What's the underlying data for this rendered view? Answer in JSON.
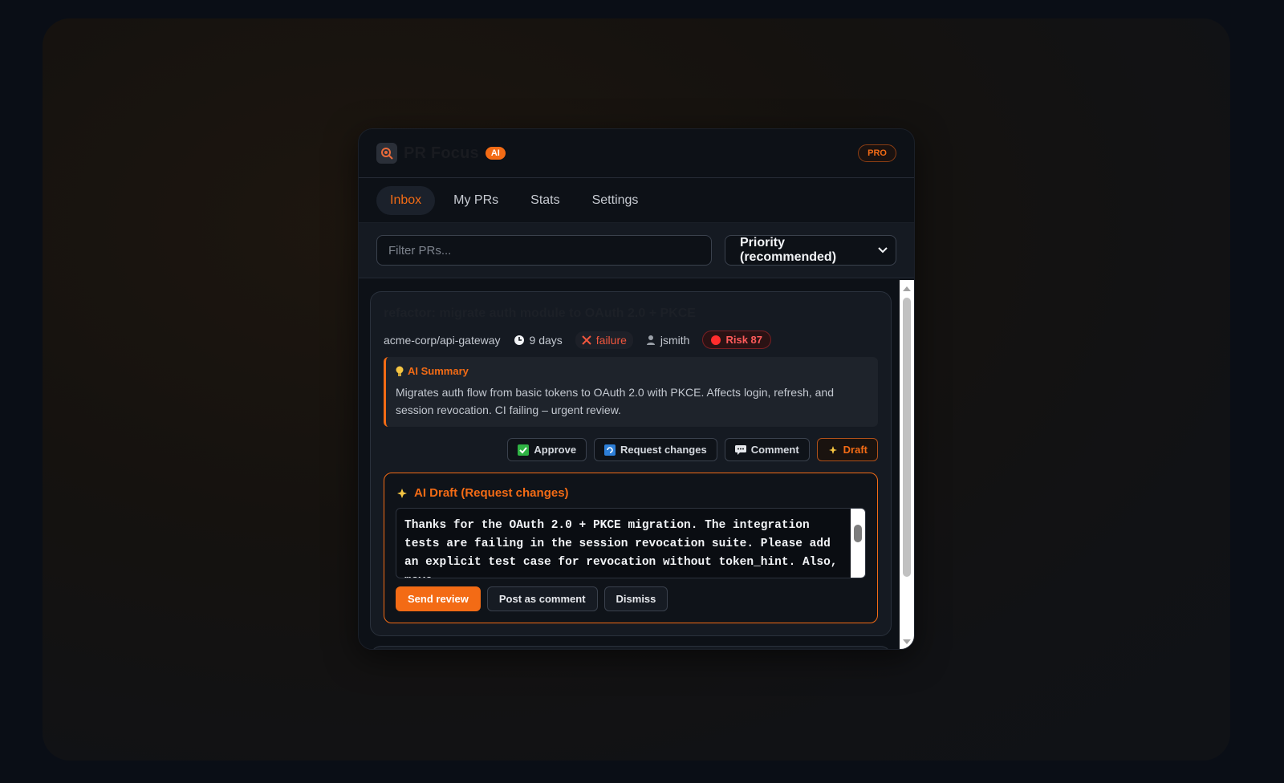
{
  "header": {
    "title": "PR Focus",
    "ai_badge": "AI",
    "pro_badge": "PRO"
  },
  "tabs": [
    {
      "label": "Inbox",
      "active": true
    },
    {
      "label": "My PRs",
      "active": false
    },
    {
      "label": "Stats",
      "active": false
    },
    {
      "label": "Settings",
      "active": false
    }
  ],
  "filter": {
    "placeholder": "Filter PRs...",
    "value": ""
  },
  "sort": {
    "selected": "Priority (recommended)"
  },
  "pr": {
    "title": "refactor: migrate auth module to OAuth 2.0 + PKCE",
    "repo": "acme-corp/api-gateway",
    "age": "9 days",
    "ci_status": "failure",
    "author": "jsmith",
    "risk": "Risk 87",
    "summary_label": "AI Summary",
    "summary_text": "Migrates auth flow from basic tokens to OAuth 2.0 with PKCE. Affects login, refresh, and session revocation. CI failing – urgent review.",
    "actions": {
      "approve": "Approve",
      "request_changes": "Request changes",
      "comment": "Comment",
      "draft": "Draft"
    },
    "draft": {
      "title": "AI Draft (Request changes)",
      "text": "Thanks for the OAuth 2.0 + PKCE migration. The integration tests are failing in the session revocation suite. Please add an explicit test case for revocation without token_hint. Also, move",
      "send": "Send review",
      "post_comment": "Post as comment",
      "dismiss": "Dismiss"
    }
  },
  "colors": {
    "accent": "#f36b15",
    "danger": "#ff5b5b",
    "background": "#0d1117"
  }
}
